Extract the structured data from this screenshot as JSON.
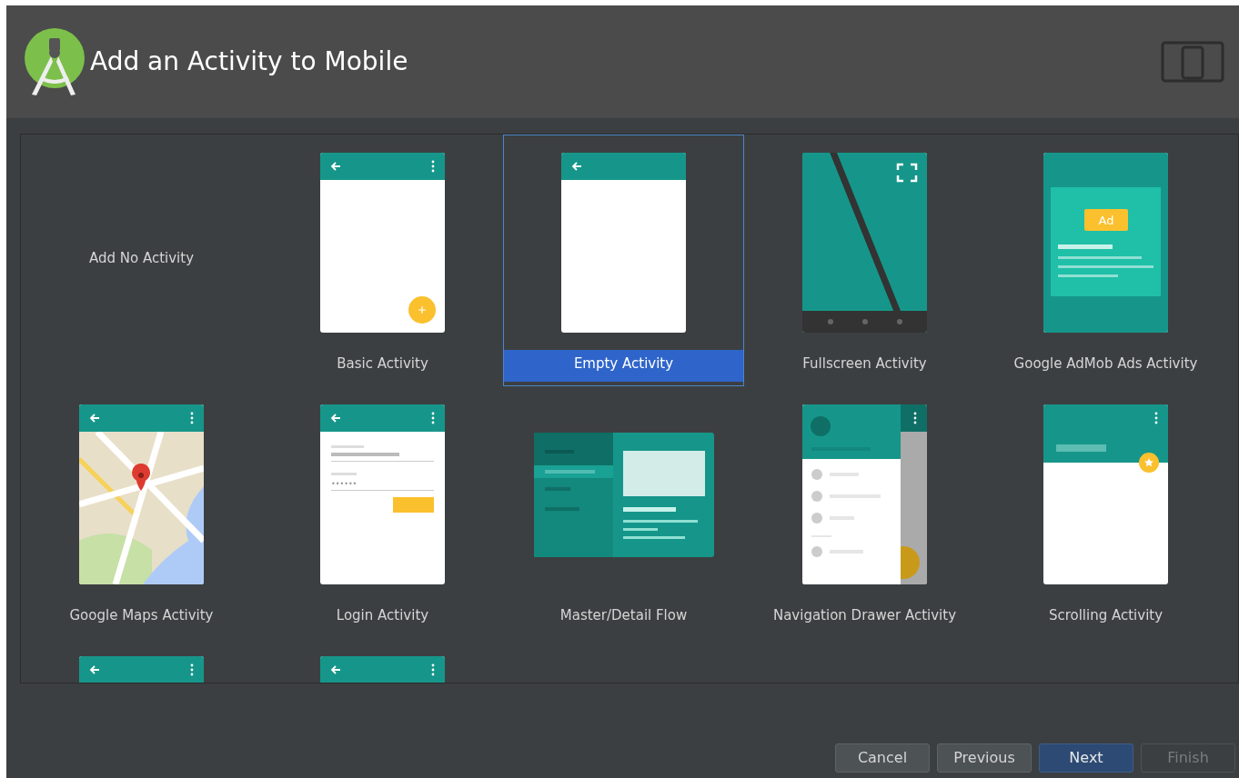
{
  "window": {
    "title": "Add an Activity to Mobile"
  },
  "templates": [
    {
      "label": "Add No Activity",
      "kind": "none",
      "selected": false
    },
    {
      "label": "Basic Activity",
      "kind": "basic",
      "selected": false
    },
    {
      "label": "Empty Activity",
      "kind": "empty",
      "selected": true
    },
    {
      "label": "Fullscreen Activity",
      "kind": "fullscreen",
      "selected": false
    },
    {
      "label": "Google AdMob Ads Activity",
      "kind": "admob",
      "preview_text": "Ad",
      "selected": false
    },
    {
      "label": "Google Maps Activity",
      "kind": "maps",
      "selected": false
    },
    {
      "label": "Login Activity",
      "kind": "login",
      "preview_text": "••••••",
      "selected": false
    },
    {
      "label": "Master/Detail Flow",
      "kind": "master-detail",
      "selected": false
    },
    {
      "label": "Navigation Drawer Activity",
      "kind": "nav-drawer",
      "selected": false
    },
    {
      "label": "Scrolling Activity",
      "kind": "scrolling",
      "selected": false
    },
    {
      "kind": "appbar",
      "selected": false
    },
    {
      "kind": "appbar",
      "selected": false
    }
  ],
  "buttons": [
    {
      "label": "Cancel",
      "kind": "default",
      "disabled": false
    },
    {
      "label": "Previous",
      "kind": "default",
      "disabled": false
    },
    {
      "label": "Next",
      "kind": "primary",
      "disabled": false
    },
    {
      "label": "Finish",
      "kind": "default",
      "disabled": true
    }
  ]
}
